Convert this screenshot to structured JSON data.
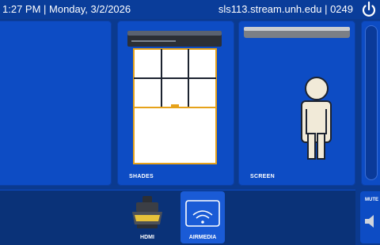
{
  "status_bar": {
    "time": "1:27 PM",
    "date": "Monday, 3/2/2026",
    "datetime_text": "1:27 PM  |  Monday, 3/2/2026",
    "host": "sls113.stream.unh.edu",
    "room": "0249",
    "host_room_text": "sls113.stream.unh.edu  |  0249",
    "power_icon": "power-icon"
  },
  "panels": {
    "shades": {
      "label": "SHADES",
      "icon": "window-shade-icon"
    },
    "screen": {
      "label": "SCREEN",
      "icon": "projector-screen-icon"
    }
  },
  "sources": [
    {
      "label": "HDMI",
      "icon": "hdmi-connector-icon",
      "selected": false
    },
    {
      "label": "AIRMEDIA",
      "icon": "airmedia-icon",
      "selected": true
    }
  ],
  "audio": {
    "mute_label": "MUTE",
    "icon": "speaker-icon"
  },
  "colors": {
    "background": "#0b3a8f",
    "panel": "#0d4cc4",
    "bottom_bar": "#0a3278",
    "selected_source": "#1a5bd6",
    "shade_frame": "#e6a21a"
  }
}
